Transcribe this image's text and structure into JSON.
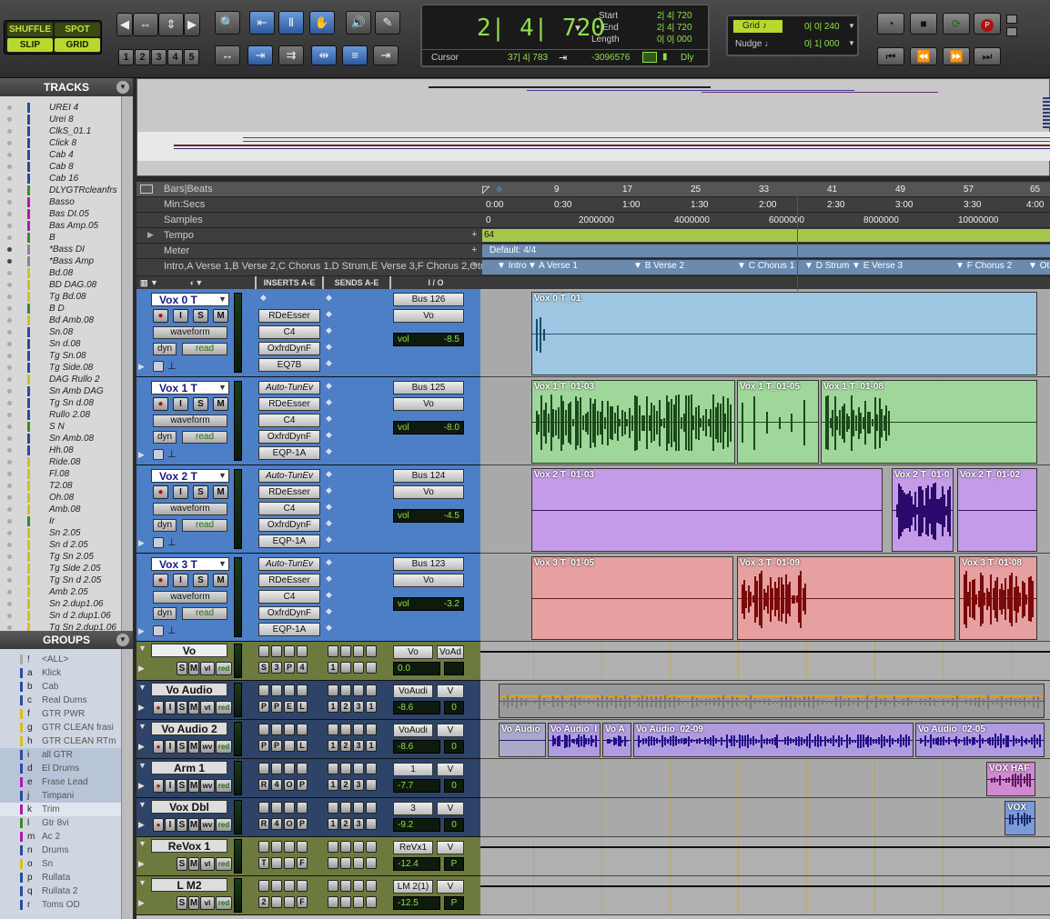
{
  "modes": {
    "shuffle": "SHUFFLE",
    "spot": "SPOT",
    "slip": "SLIP",
    "grid": "GRID"
  },
  "zoom_presets": [
    "1",
    "2",
    "3",
    "4",
    "5"
  ],
  "counter": {
    "main": "2| 4| 720",
    "start_label": "Start",
    "start": "2| 4| 720",
    "end_label": "End",
    "end": "2| 4| 720",
    "length_label": "Length",
    "length": "0| 0| 000",
    "cursor_label": "Cursor",
    "cursor": "37| 4| 783",
    "samples": "-3096576",
    "dly": "Dly"
  },
  "grid": {
    "label": "Grid",
    "value": "0| 0| 240"
  },
  "nudge": {
    "label": "Nudge",
    "value": "0| 1| 000"
  },
  "panels": {
    "tracks": "TRACKS",
    "groups": "GROUPS"
  },
  "track_list": [
    "UREI 4",
    "Urei 8",
    "ClkS_01.1",
    "Click 8",
    "Cab 4",
    "Cab 8",
    "Cab 16",
    "DLYGTRcleanfrs",
    "Basso",
    "Bas DI.05",
    "Bas Amp.05",
    "B",
    "*Bass DI",
    "*Bass Amp",
    "Bd.08",
    "BD DAG.08",
    "Tg Bd.08",
    "B D",
    "Bd Amb.08",
    "Sn.08",
    "Sn d.08",
    "Tg Sn.08",
    "Tg Side.08",
    "DAG Rullo 2",
    "Sn Amb DAG",
    "Tg Sn d.08",
    "Rullo 2.08",
    "S N",
    "Sn Amb.08",
    "Hh.08",
    "Ride.08",
    "Fl.08",
    "T2.08",
    "Oh.08",
    "Amb.08",
    "Ir",
    "Sn 2.05",
    "Sn d 2.05",
    "Tg Sn 2.05",
    "Tg Side 2.05",
    "Tg Sn d 2.05",
    "Amb 2.05",
    "Sn 2.dup1.06",
    "Sn d 2.dup1.06",
    "Tg Sn 2.dup1.06"
  ],
  "groups": [
    {
      "id": "!",
      "name": "<ALL>"
    },
    {
      "id": "a",
      "name": "Klick"
    },
    {
      "id": "b",
      "name": "Cab"
    },
    {
      "id": "c",
      "name": "Real Dums"
    },
    {
      "id": "f",
      "name": "GTR PWR"
    },
    {
      "id": "g",
      "name": "GTR CLEAN frasi"
    },
    {
      "id": "h",
      "name": "GTR CLEAN RTm"
    },
    {
      "id": "i",
      "name": "all GTR"
    },
    {
      "id": "d",
      "name": "El Drums"
    },
    {
      "id": "e",
      "name": "Frase Lead"
    },
    {
      "id": "j",
      "name": "Timpani"
    },
    {
      "id": "k",
      "name": "Trim"
    },
    {
      "id": "l",
      "name": "Gtr 8vi"
    },
    {
      "id": "m",
      "name": "Ac 2"
    },
    {
      "id": "n",
      "name": "Drums"
    },
    {
      "id": "o",
      "name": "Sn"
    },
    {
      "id": "p",
      "name": "Rullata"
    },
    {
      "id": "q",
      "name": "Rullata 2"
    },
    {
      "id": "r",
      "name": "Toms OD"
    }
  ],
  "rulers": {
    "bars_beats": "Bars|Beats",
    "min_secs": "Min:Secs",
    "samples": "Samples",
    "tempo": "Tempo",
    "meter": "Meter",
    "markers": [
      "Intro",
      "A  Verse 1",
      "B  Verse 2",
      "C  Chorus 1",
      "D  Strum",
      "E  Verse 3",
      "F  Chorus 2",
      "Otr"
    ],
    "bar_ticks": [
      "9",
      "17",
      "25",
      "33",
      "41",
      "49",
      "57",
      "65"
    ],
    "min_ticks": [
      "0:00",
      "0:30",
      "1:00",
      "1:30",
      "2:00",
      "2:30",
      "3:00",
      "3:30",
      "4:00"
    ],
    "sample_ticks": [
      "0",
      "2000000",
      "4000000",
      "6000000",
      "8000000",
      "10000000"
    ],
    "tempo_value": "64",
    "meter_value": "Default: 4/4"
  },
  "columns": {
    "inserts": "INSERTS A-E",
    "sends": "SENDS A-E",
    "io": "I / O"
  },
  "tracks": [
    {
      "name": "Vox 0 T",
      "view": "waveform",
      "auto": "read",
      "dyn": "dyn",
      "inserts": [
        "",
        "RDeEsser",
        "C4",
        "OxfrdDynF",
        "EQ7B"
      ],
      "output": "Bus 126",
      "input": "Vo",
      "vol_label": "vol",
      "vol": "-8.5"
    },
    {
      "name": "Vox 1 T",
      "view": "waveform",
      "auto": "read",
      "dyn": "dyn",
      "inserts": [
        "Auto-TunEv",
        "RDeEsser",
        "C4",
        "OxfrdDynF",
        "EQP-1A"
      ],
      "output": "Bus 125",
      "input": "Vo",
      "vol_label": "vol",
      "vol": "-8.0"
    },
    {
      "name": "Vox 2 T",
      "view": "waveform",
      "auto": "read",
      "dyn": "dyn",
      "inserts": [
        "Auto-TunEv",
        "RDeEsser",
        "C4",
        "OxfrdDynF",
        "EQP-1A"
      ],
      "output": "Bus 124",
      "input": "Vo",
      "vol_label": "vol",
      "vol": "-4.5"
    },
    {
      "name": "Vox 3 T",
      "view": "waveform",
      "auto": "read",
      "dyn": "dyn",
      "inserts": [
        "Auto-TunEv",
        "RDeEsser",
        "C4",
        "OxfrdDynF",
        "EQP-1A"
      ],
      "output": "Bus 123",
      "input": "Vo",
      "vol_label": "vol",
      "vol": "-3.2"
    }
  ],
  "small_tracks": [
    {
      "name": "Vo",
      "io1": "Vo",
      "io2": "VoAd",
      "vol_label": "vol",
      "vol": "0.0",
      "pan": "",
      "b1": "S",
      "b2": "3",
      "b3": "P",
      "b4": "4",
      "b5": "1"
    },
    {
      "name": "Vo Audio",
      "io1": "VoAudi",
      "io2": "V",
      "vol": "-8.6",
      "pan": "0",
      "b1": "P",
      "b2": "P",
      "b3": "E",
      "b4": "L",
      "b5": "1",
      "b6": "2",
      "b7": "3",
      "b8": "1"
    },
    {
      "name": "Vo Audio 2",
      "io1": "VoAudi",
      "io2": "V",
      "vol": "-8.6",
      "pan": "0",
      "b1": "P",
      "b2": "P",
      "b3": "",
      "b4": "L",
      "b5": "1",
      "b6": "2",
      "b7": "3",
      "b8": "1"
    },
    {
      "name": "Arm 1",
      "io1": "1",
      "io2": "V",
      "vol": "-7.7",
      "pan": "0",
      "b1": "R",
      "b2": "4",
      "b3": "O",
      "b4": "P",
      "b5": "1",
      "b6": "2",
      "b7": "3",
      "b8": ""
    },
    {
      "name": "Vox Dbl",
      "io1": "3",
      "io2": "V",
      "vol": "-9.2",
      "pan": "0",
      "b1": "R",
      "b2": "4",
      "b3": "O",
      "b4": "P",
      "b5": "1",
      "b6": "2",
      "b7": "3",
      "b8": ""
    },
    {
      "name": "ReVox 1",
      "io1": "ReVx1",
      "io2": "V",
      "vol": "-12.4",
      "pan": "P",
      "b1": "T",
      "b2": "",
      "b3": "",
      "b4": "F",
      "b5": "",
      "b6": "",
      "b7": "",
      "b8": ""
    },
    {
      "name": "L M2",
      "io1": "LM 2(1)",
      "io2": "V",
      "vol": "-12.5",
      "pan": "P",
      "b1": "2",
      "b2": "",
      "b3": "",
      "b4": "F",
      "b5": "",
      "b6": "",
      "b7": "",
      "b8": ""
    }
  ],
  "regions": {
    "vox0": [
      "Vox 0 T_01"
    ],
    "vox1": [
      "Vox 1 T_01-03",
      "Vox 1 T_01-05",
      "Vox 1 T_01-08"
    ],
    "vox2": [
      "Vox 2 T_01-03",
      "Vox 2 T_01-0",
      "Vox 2 T_01-02"
    ],
    "vox3": [
      "Vox 3 T_01-05",
      "Vox 3 T_01-09",
      "Vox 3 T_01-08"
    ],
    "voaudio2": [
      "Vo Audio",
      "Vo Audio_I",
      "Vo A",
      "Vo Audio_02-09",
      "Vo Audio_02-05"
    ],
    "arm1": [
      "VOX HAF"
    ],
    "voxdbl": [
      "VOX"
    ]
  },
  "btn_labels": {
    "rec": "●",
    "input": "I",
    "solo": "S",
    "mute": "M",
    "dyn": "dyn",
    "read": "read",
    "vt": "vt",
    "wv": "wv",
    "vl": "vl",
    "red": "red"
  },
  "colors": {
    "accent_green": "#b7d92e",
    "lcd_text": "#8fe04a",
    "track_blue": "#4d7fc7",
    "vox0": "#9cc6e2",
    "vox1": "#9fd69a",
    "vox2": "#c49be6",
    "vox3": "#e6a0a0"
  }
}
